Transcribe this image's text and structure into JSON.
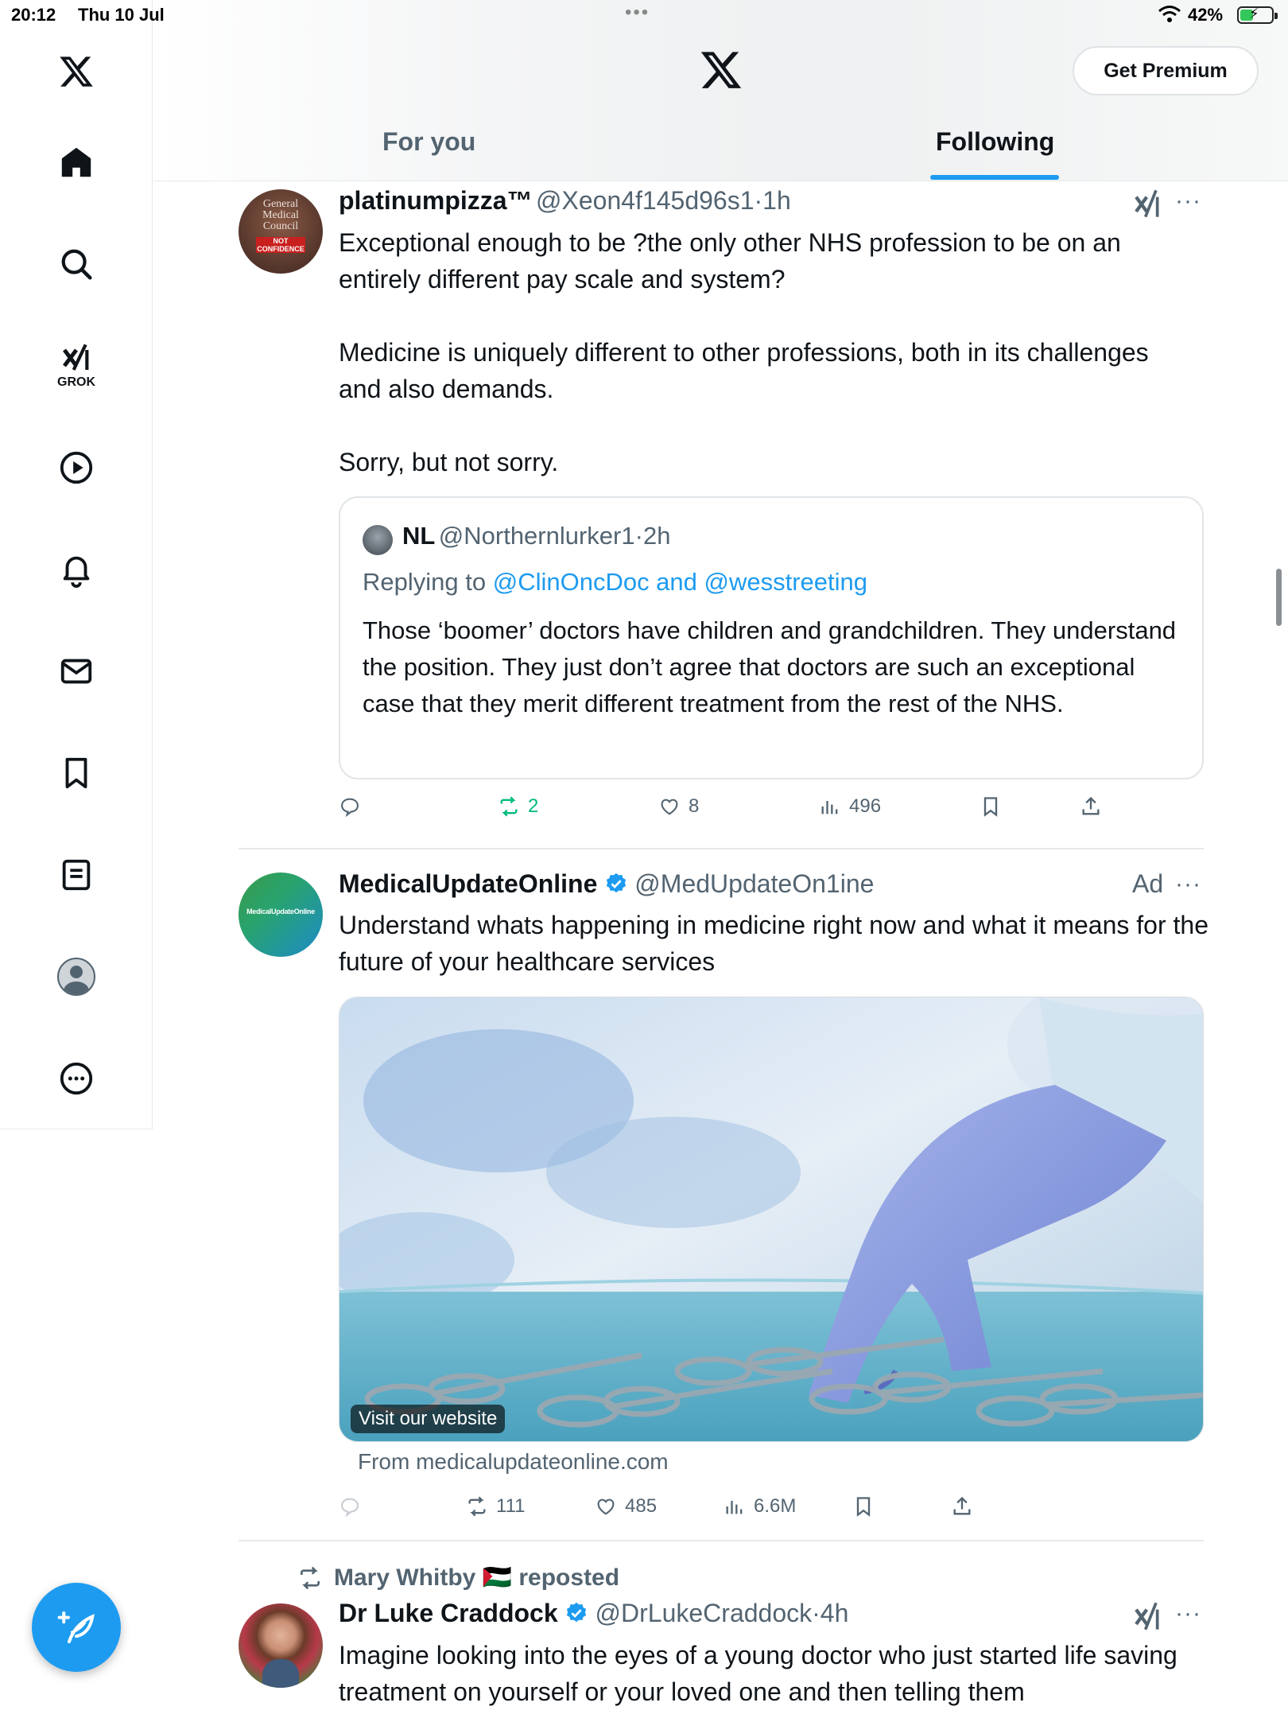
{
  "status_bar": {
    "time": "20:12",
    "date": "Thu 10 Jul",
    "battery": "42%",
    "battery_fraction": 0.42
  },
  "sidebar": {
    "grok_label": "GROK"
  },
  "header": {
    "premium_label": "Get Premium",
    "tabs": [
      {
        "label": "For you",
        "active": false
      },
      {
        "label": "Following",
        "active": true
      }
    ],
    "accent_color": "#1d9bf0"
  },
  "tweets": [
    {
      "name": "platinumpizza™",
      "handle": "@Xeon4f145d96s1",
      "time": "1h",
      "body": "Exceptional enough to be ?the only other NHS profession to be on an entirely different pay scale and system?\n\nMedicine is uniquely different to other professions, both in its challenges and also demands.\n\nSorry, but not sorry.",
      "avatar_text": [
        "General",
        "Medical",
        "Council",
        "NOT",
        "CONFIDENCE"
      ],
      "quote": {
        "name": "NL",
        "handle": "@Northernlurker1",
        "time": "2h",
        "replying_prefix": "Replying to",
        "replying_to": "@ClinOncDoc and @wesstreeting",
        "body": "Those ‘boomer’ doctors have children and grandchildren. They understand the position. They just don’t agree that doctors are such an exceptional case that they merit different treatment from the rest of the NHS."
      },
      "actions": {
        "replies": "",
        "reposts": "2",
        "likes": "8",
        "views": "496"
      }
    },
    {
      "name": "MedicalUpdateOnline",
      "handle": "@MedUpdateOn1ine",
      "ad_label": "Ad",
      "body": "Understand whats happening in medicine right now and what it means for the future of your healthcare services",
      "avatar_text": "MedicalUpdateOnline",
      "image_badge": "Visit our website",
      "source": "From medicalupdateonline.com",
      "actions": {
        "replies": "",
        "reposts": "111",
        "likes": "485",
        "views": "6.6M"
      }
    },
    {
      "reposted_by": "Mary Whitby 🇵🇸 reposted",
      "name": "Dr Luke Craddock",
      "handle": "@DrLukeCraddock",
      "time": "4h",
      "body": "Imagine looking into the eyes of a young doctor who just started life saving treatment on yourself or your loved one and then telling them"
    }
  ]
}
